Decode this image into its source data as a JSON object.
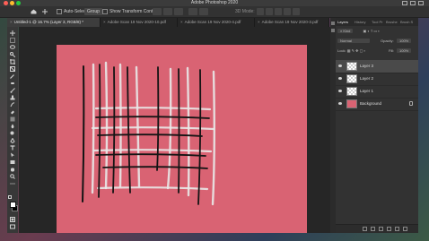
{
  "window": {
    "title": "Adobe Photoshop 2020"
  },
  "options_bar": {
    "auto_select_label": "Auto-Select:",
    "auto_select_value": "Group",
    "show_transform_label": "Show Transform Controls",
    "mode_label": "3D Mode:"
  },
  "tabs": [
    {
      "label": "Untitled-1 @ 16.7% (Layer 3, RGB/8) *",
      "active": true
    },
    {
      "label": "Adobe Scan 19 Nov 2020-10.pdf",
      "active": false
    },
    {
      "label": "Adobe Scan 19 Nov 2020-4.pdf",
      "active": false
    },
    {
      "label": "Adobe Scan 19 Nov 2020-3.pdf",
      "active": false
    }
  ],
  "panel": {
    "tabs": [
      "Layers",
      "History",
      "Tool Pr",
      "Brushe",
      "Brush S"
    ],
    "kind_label": "Kind",
    "blend_mode": "Normal",
    "opacity_label": "Opacity:",
    "opacity_value": "100%",
    "lock_label": "Lock:",
    "fill_label": "Fill:",
    "fill_value": "100%",
    "layers": [
      {
        "name": "Layer 3",
        "selected": true,
        "thumb": "transparent"
      },
      {
        "name": "Layer 2",
        "selected": false,
        "thumb": "transparent"
      },
      {
        "name": "Layer 1",
        "selected": false,
        "thumb": "transparent"
      },
      {
        "name": "Background",
        "selected": false,
        "thumb": "pink",
        "locked": true
      }
    ]
  },
  "colors": {
    "canvas_pink": "#d96373",
    "ui_dark": "#323232",
    "stroke_black": "#141414",
    "stroke_white": "#e8e8e8"
  },
  "icons": [
    "home-icon",
    "move-tool-icon",
    "marquee-tool-icon",
    "lasso-tool-icon",
    "crop-tool-icon",
    "eyedropper-icon",
    "brush-tool-icon",
    "eraser-tool-icon",
    "type-tool-icon",
    "hand-tool-icon",
    "zoom-tool-icon",
    "eye-icon",
    "lock-icon"
  ]
}
